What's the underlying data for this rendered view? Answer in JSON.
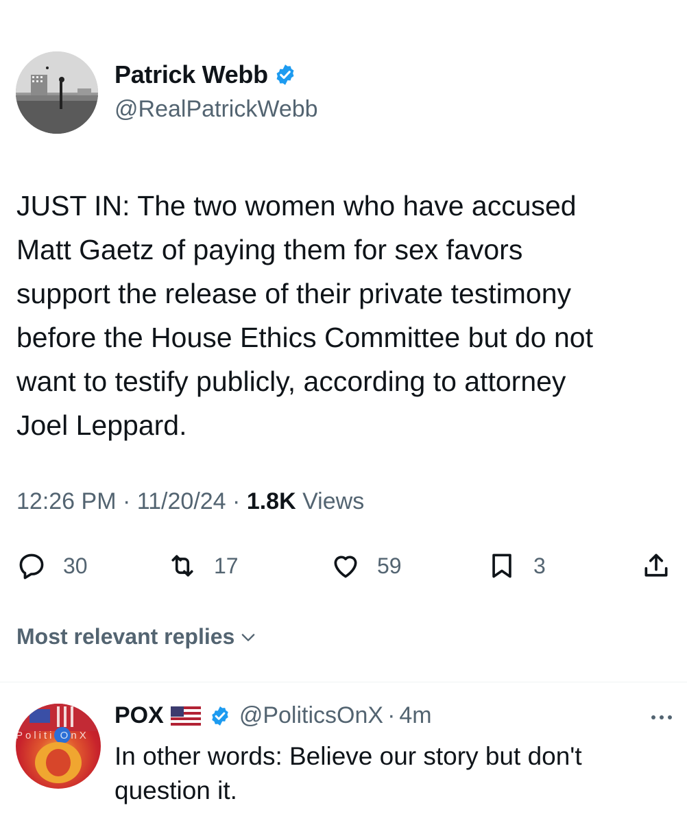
{
  "tweet": {
    "author": {
      "display_name": "Patrick Webb",
      "handle": "@RealPatrickWebb",
      "verified": true,
      "avatar_icon": "profile-photo"
    },
    "text": "JUST IN: The two women who have accused\nMatt Gaetz of paying them for sex favors\nsupport the release of their private testimony\nbefore the House Ethics Committee but do not\nwant to testify publicly, according to attorney\nJoel Leppard.",
    "time": "12:26 PM",
    "date": "11/20/24",
    "separator": "·",
    "views_count": "1.8K",
    "views_label": "Views",
    "actions": {
      "reply_count": "30",
      "retweet_count": "17",
      "like_count": "59",
      "bookmark_count": "3"
    }
  },
  "replies_sort": {
    "label": "Most relevant replies"
  },
  "reply": {
    "display_name": "POX",
    "flag": "us-flag",
    "verified": true,
    "handle": "@PoliticsOnX",
    "time": "4m",
    "text": "In other words: Believe our story but don't\nquestion it.",
    "avatar_text": "PolitiOnX"
  },
  "colors": {
    "text": "#0f1419",
    "secondary": "#536471",
    "verified": "#1d9bf0",
    "divider": "#eff3f4"
  }
}
